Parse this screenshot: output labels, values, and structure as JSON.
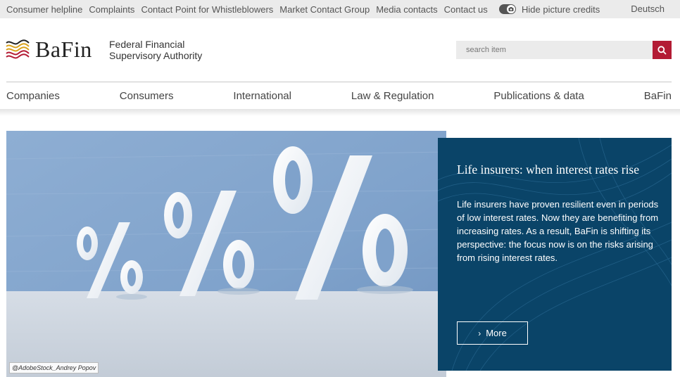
{
  "topbar": {
    "links": [
      "Consumer helpline",
      "Complaints",
      "Contact Point for Whistleblowers",
      "Market Contact Group",
      "Media contacts",
      "Contact us"
    ],
    "picture_credits_label": "Hide picture credits",
    "picture_credits_on": true,
    "language_link": "Deutsch"
  },
  "header": {
    "logo_text": "BaFin",
    "authority_line1": "Federal Financial",
    "authority_line2": "Supervisory Authority",
    "search_placeholder": "search item",
    "search_icon": "search-icon"
  },
  "nav": {
    "items": [
      "Companies",
      "Consumers",
      "International",
      "Law & Regulation",
      "Publications & data",
      "BaFin"
    ]
  },
  "hero": {
    "photo_credit": "@AdobeStock_Andrey Popov"
  },
  "teaser": {
    "title": "Life insurers: when interest rates rise",
    "text": "Life insurers have proven resilient even in periods of low interest rates. Now they are benefiting from increasing rates. As a result, BaFin is shifting its perspective: the focus now is on the risks arising from rising interest rates.",
    "more_label": "More"
  },
  "colors": {
    "accent_red": "#b31b34",
    "panel_blue": "#0a4468",
    "topbar_gray": "#ebebeb"
  }
}
